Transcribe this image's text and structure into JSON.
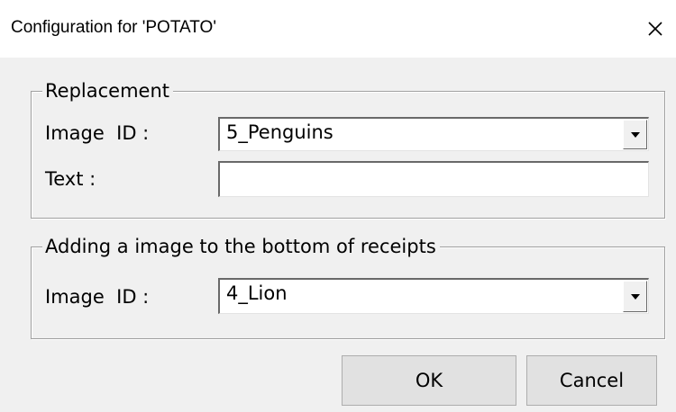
{
  "window": {
    "title": "Configuration for 'POTATO'",
    "close_glyph": "✕"
  },
  "replacement": {
    "legend": "Replacement",
    "image_id_label": "Image  ID :",
    "image_id_value": "5_Penguins",
    "text_label": "Text :",
    "text_value": ""
  },
  "receipt_image": {
    "legend": "Adding a image to the bottom of receipts",
    "image_id_label": "Image  ID :",
    "image_id_value": "4_Lion"
  },
  "buttons": {
    "ok_label": "OK",
    "cancel_label": "Cancel"
  }
}
